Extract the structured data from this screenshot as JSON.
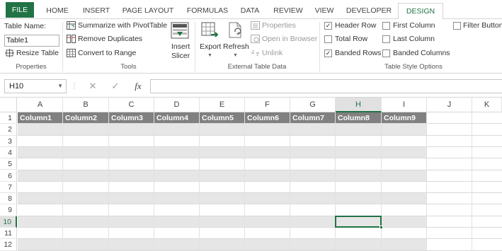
{
  "tabs": [
    {
      "label": "FILE",
      "name": "tab-file"
    },
    {
      "label": "HOME",
      "name": "tab-home"
    },
    {
      "label": "INSERT",
      "name": "tab-insert"
    },
    {
      "label": "PAGE LAYOUT",
      "name": "tab-page-layout"
    },
    {
      "label": "FORMULAS",
      "name": "tab-formulas"
    },
    {
      "label": "DATA",
      "name": "tab-data"
    },
    {
      "label": "REVIEW",
      "name": "tab-review"
    },
    {
      "label": "VIEW",
      "name": "tab-view"
    },
    {
      "label": "DEVELOPER",
      "name": "tab-developer"
    },
    {
      "label": "DESIGN",
      "name": "tab-design"
    }
  ],
  "ribbon": {
    "properties": {
      "table_name_label": "Table Name:",
      "table_name_value": "Table1",
      "resize_label": "Resize Table",
      "group_label": "Properties"
    },
    "tools": {
      "summarize_label": "Summarize with PivotTable",
      "remove_dup_label": "Remove Duplicates",
      "convert_label": "Convert to Range",
      "insert_slicer_line1": "Insert",
      "insert_slicer_line2": "Slicer",
      "group_label": "Tools"
    },
    "external": {
      "export_label": "Export",
      "refresh_label": "Refresh",
      "properties_label": "Properties",
      "open_browser_label": "Open in Browser",
      "unlink_label": "Unlink",
      "group_label": "External Table Data"
    },
    "style_options": {
      "header_row": {
        "label": "Header Row",
        "checked": true
      },
      "total_row": {
        "label": "Total Row",
        "checked": false
      },
      "banded_rows": {
        "label": "Banded Rows",
        "checked": true
      },
      "first_column": {
        "label": "First Column",
        "checked": false
      },
      "last_column": {
        "label": "Last Column",
        "checked": false
      },
      "banded_columns": {
        "label": "Banded Columns",
        "checked": false
      },
      "filter_button": {
        "label": "Filter Button",
        "checked": false
      },
      "group_label": "Table Style Options"
    }
  },
  "formula_bar": {
    "name_box": "H10",
    "fx_label": "fx",
    "cancel_glyph": "✕",
    "enter_glyph": "✓",
    "formula_value": ""
  },
  "sheet": {
    "columns": [
      "A",
      "B",
      "C",
      "D",
      "E",
      "F",
      "G",
      "H",
      "I",
      "J",
      "K"
    ],
    "selected_column": "H",
    "rows": [
      "1",
      "2",
      "3",
      "4",
      "5",
      "6",
      "7",
      "8",
      "9",
      "10",
      "11",
      "12"
    ],
    "selected_row": "10",
    "table_headers": [
      "Column1",
      "Column2",
      "Column3",
      "Column4",
      "Column5",
      "Column6",
      "Column7",
      "Column8",
      "Column9"
    ],
    "active_cell": "H10"
  },
  "colors": {
    "accent": "#217346",
    "table_header": "#808080",
    "band": "#e6e6e6"
  }
}
